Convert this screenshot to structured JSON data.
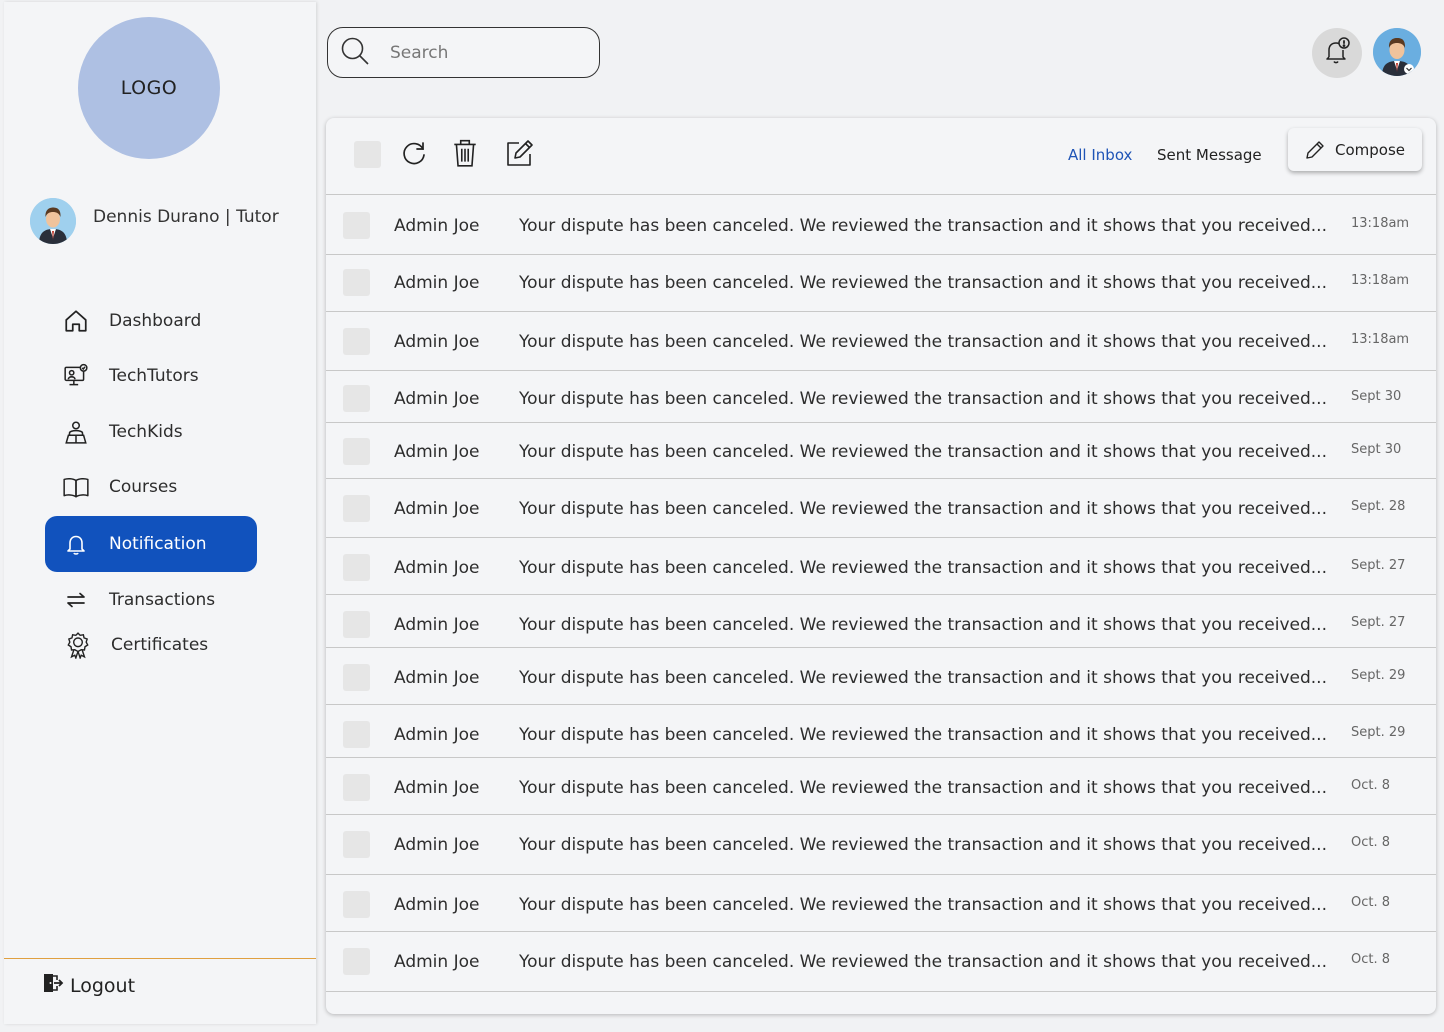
{
  "sidebar": {
    "logo": "LOGO",
    "user_name": "Dennis Durano | Tutor",
    "items": [
      {
        "label": "Dashboard",
        "icon": "home-icon"
      },
      {
        "label": "TechTutors",
        "icon": "tutor-icon"
      },
      {
        "label": "TechKids",
        "icon": "kids-icon"
      },
      {
        "label": "Courses",
        "icon": "book-icon"
      },
      {
        "label": "Notification",
        "icon": "bell-icon",
        "active": true
      },
      {
        "label": "Transactions",
        "icon": "transfer-icon"
      },
      {
        "label": "Certificates",
        "icon": "certificate-icon"
      }
    ],
    "logout": "Logout"
  },
  "header": {
    "search_placeholder": "Search"
  },
  "toolbar": {
    "all_inbox": "All Inbox",
    "sent_message": "Sent Message",
    "compose": "Compose"
  },
  "colors": {
    "accent": "#1152bd",
    "logo_bg": "#aec0e3",
    "divider": "#e0a040"
  },
  "messages": [
    {
      "sender": "Admin Joe",
      "text": "Your dispute has been canceled. We reviewed the transaction and it shows that you received...",
      "time": "13:18am"
    },
    {
      "sender": "Admin Joe",
      "text": "Your dispute has been canceled. We reviewed the transaction and it shows that you received...",
      "time": "13:18am"
    },
    {
      "sender": "Admin Joe",
      "text": "Your dispute has been canceled. We reviewed the transaction and it shows that you received...",
      "time": "13:18am"
    },
    {
      "sender": "Admin Joe",
      "text": "Your dispute has been canceled. We reviewed the transaction and it shows that you received...",
      "time": "Sept 30"
    },
    {
      "sender": "Admin Joe",
      "text": "Your dispute has been canceled. We reviewed the transaction and it shows that you received...",
      "time": "Sept 30"
    },
    {
      "sender": "Admin Joe",
      "text": "Your dispute has been canceled. We reviewed the transaction and it shows that you received...",
      "time": "Sept. 28"
    },
    {
      "sender": "Admin Joe",
      "text": "Your dispute has been canceled. We reviewed the transaction and it shows that you received...",
      "time": "Sept. 27"
    },
    {
      "sender": "Admin Joe",
      "text": "Your dispute has been canceled. We reviewed the transaction and it shows that you received...",
      "time": "Sept. 27"
    },
    {
      "sender": "Admin Joe",
      "text": "Your dispute has been canceled. We reviewed the transaction and it shows that you received...",
      "time": "Sept. 29"
    },
    {
      "sender": "Admin Joe",
      "text": "Your dispute has been canceled. We reviewed the transaction and it shows that you received...",
      "time": "Sept. 29"
    },
    {
      "sender": "Admin Joe",
      "text": "Your dispute has been canceled. We reviewed the transaction and it shows that you received...",
      "time": "Oct. 8"
    },
    {
      "sender": "Admin Joe",
      "text": "Your dispute has been canceled. We reviewed the transaction and it shows that you received...",
      "time": "Oct. 8"
    },
    {
      "sender": "Admin Joe",
      "text": "Your dispute has been canceled. We reviewed the transaction and it shows that you received...",
      "time": "Oct. 8"
    },
    {
      "sender": "Admin Joe",
      "text": "Your dispute has been canceled. We reviewed the transaction and it shows that you received...",
      "time": "Oct. 8"
    }
  ]
}
